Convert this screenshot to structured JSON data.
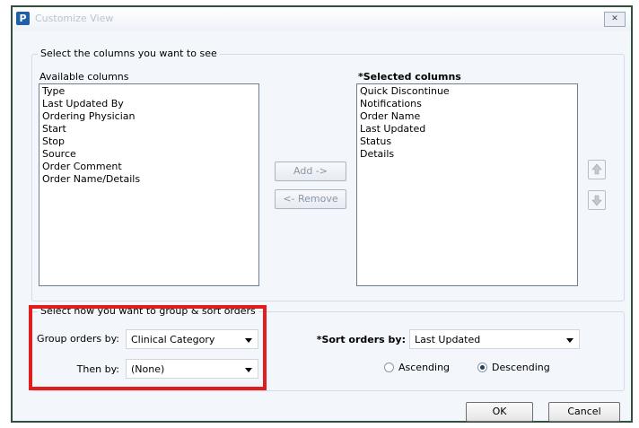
{
  "window": {
    "title": "Customize View",
    "app_icon": "P",
    "close_symbol": "✕"
  },
  "columns_group": {
    "legend": "Select the columns you want to see",
    "available_label": "Available columns",
    "available_items": [
      "Type",
      "Last Updated By",
      "Ordering Physician",
      "Start",
      "Stop",
      "Source",
      "Order Comment",
      "Order Name/Details"
    ],
    "selected_label": "*Selected columns",
    "selected_items": [
      "Quick Discontinue",
      "Notifications",
      "Order Name",
      "Last Updated",
      "Status",
      "Details"
    ],
    "add_button": "Add ->",
    "remove_button": "<- Remove",
    "move_up_icon": "up-arrow-icon",
    "move_down_icon": "down-arrow-icon"
  },
  "sort_group": {
    "legend": "Select how you want to group & sort orders",
    "group_by_label": "Group orders by:",
    "group_by_value": "Clinical Category",
    "then_by_label": "Then by:",
    "then_by_value": "(None)",
    "sort_by_label": "*Sort orders by:",
    "sort_by_value": "Last Updated",
    "ascending_label": "Ascending",
    "descending_label": "Descending",
    "selected_order": "Descending"
  },
  "footer": {
    "ok": "OK",
    "cancel": "Cancel"
  },
  "colors": {
    "highlight": "#e11d1d",
    "dialog_bg": "#f3f6fb"
  }
}
